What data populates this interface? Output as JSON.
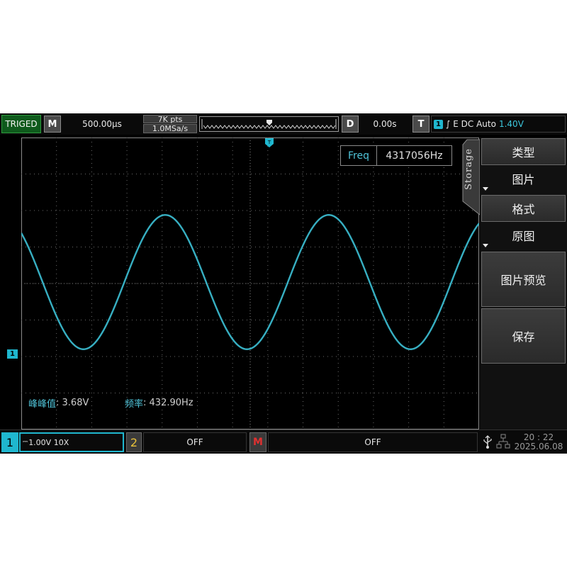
{
  "topbar": {
    "status": "TRIGED",
    "mode_letter": "M",
    "timebase": "500.00μs",
    "points": "7K pts",
    "sample_rate": "1.0MSa/s",
    "delay_letter": "D",
    "delay": "0.00s",
    "trigger_letter": "T",
    "trigger_channel": "1",
    "trigger_edge_symbol": "∫",
    "trigger_mode": "E DC Auto",
    "trigger_level": "1.40V"
  },
  "grid": {
    "trigger_marker": "T",
    "channel_marker": "1",
    "freq_label": "Freq",
    "freq_value": "4317056Hz",
    "measurements": [
      {
        "label": "峰峰值",
        "value": ": 3.68V"
      },
      {
        "label": "频率",
        "value": ": 432.90Hz"
      }
    ],
    "waveform": {
      "color": "#3ab8cc",
      "periods_visible": 2.8,
      "vpp_divisions": 3.68
    }
  },
  "side_menu": {
    "tab_label": "Storage",
    "items": [
      {
        "label": "类型",
        "value": "图片"
      },
      {
        "label": "格式",
        "value": "原图"
      },
      {
        "label": "图片预览"
      },
      {
        "label": "保存"
      }
    ]
  },
  "bottombar": {
    "ch1_number": "1",
    "ch1_settings": "1.00V 10X",
    "ch2_number": "2",
    "ch2_state": "OFF",
    "math_letter": "M",
    "math_state": "OFF",
    "time": "20 : 22",
    "date": "2025.06.08"
  },
  "colors": {
    "ch1": "#1fb7cf",
    "ch2": "#e8c23a",
    "math": "#e03030",
    "triged_bg": "#0e5a1c"
  }
}
